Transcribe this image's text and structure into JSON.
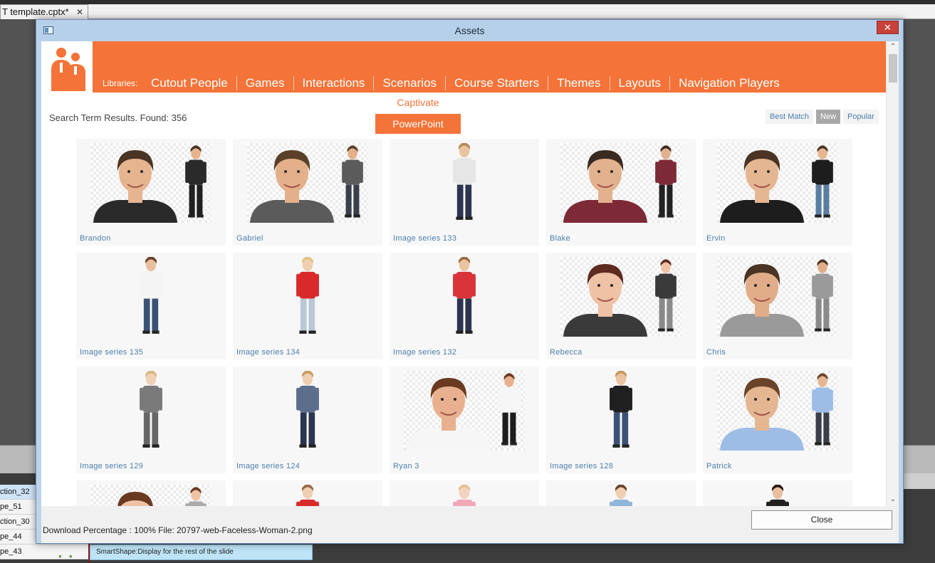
{
  "app": {
    "doc_tab": "T template.cptx*",
    "doc_tab_close": "✕",
    "timeline_rows": [
      {
        "label": "ction_32",
        "selected": true
      },
      {
        "label": "pe_51",
        "selected": false
      },
      {
        "label": "ction_30",
        "selected": false
      },
      {
        "label": "pe_44",
        "selected": false
      },
      {
        "label": "pe_43",
        "selected": false
      }
    ],
    "timeline_smartshape": "SmartShape:Display for the rest of the slide"
  },
  "dialog": {
    "title": "Assets",
    "close_glyph": "✕",
    "libraries_label": "Libraries:",
    "nav": [
      "Cutout People",
      "Games",
      "Interactions",
      "Scenarios",
      "Course Starters",
      "Themes",
      "Layouts",
      "Navigation Players"
    ],
    "submenu": {
      "captivate": "Captivate",
      "powerpoint": "PowerPoint"
    },
    "results_text": "Search Term Results. Found: 356",
    "sort_options": [
      {
        "label": "Best Match",
        "active": false
      },
      {
        "label": "New",
        "active": true
      },
      {
        "label": "Popular",
        "active": false
      }
    ],
    "scroll_up": "⌃",
    "scroll_down": "⌄",
    "grid": [
      {
        "caption": "Brandon",
        "kind": "pair",
        "skin": "#e6b48f",
        "hair": "#4a3424",
        "shirt": "#2a2a2a",
        "pants": "#202020"
      },
      {
        "caption": "Gabriel",
        "kind": "pair",
        "skin": "#e3b08a",
        "hair": "#5a4028",
        "shirt": "#5b5b5b",
        "pants": "#3a3f4a"
      },
      {
        "caption": "Image series 133",
        "kind": "single",
        "skin": "#eac3a0",
        "hair": "#b4895a",
        "shirt": "#e6e6e6",
        "pants": "#2c3550"
      },
      {
        "caption": "Blake",
        "kind": "pair",
        "skin": "#e2b18e",
        "hair": "#3a2a20",
        "shirt": "#7d2a36",
        "pants": "#222"
      },
      {
        "caption": "Ervin",
        "kind": "pair",
        "skin": "#e5b692",
        "hair": "#4b3424",
        "shirt": "#1d1d1d",
        "pants": "#5a7ea0"
      },
      {
        "caption": "Image series 135",
        "kind": "single",
        "skin": "#e8c0a0",
        "hair": "#6a4028",
        "shirt": "#f4f4f4",
        "pants": "#3b5276"
      },
      {
        "caption": "Image series 134",
        "kind": "single",
        "skin": "#efcfb2",
        "hair": "#e1c38a",
        "shirt": "#d82a2a",
        "pants": "#b9c8d4"
      },
      {
        "caption": "Image series 132",
        "kind": "single",
        "skin": "#eac3a0",
        "hair": "#9a6a40",
        "shirt": "#d8343a",
        "pants": "#2c3550"
      },
      {
        "caption": "Rebecca",
        "kind": "pair",
        "skin": "#efc2a6",
        "hair": "#5e2a20",
        "shirt": "#3a3a3a",
        "pants": "#8a8a8a"
      },
      {
        "caption": "Chris",
        "kind": "pair",
        "skin": "#e0ad88",
        "hair": "#4a3424",
        "shirt": "#9a9a9a",
        "pants": "#8a8a8a"
      },
      {
        "caption": "Image series 129",
        "kind": "single",
        "skin": "#f0d0b4",
        "hair": "#d9b880",
        "shirt": "#7a7a7a",
        "pants": "#666"
      },
      {
        "caption": "Image series 124",
        "kind": "single",
        "skin": "#efcfb2",
        "hair": "#c99a60",
        "shirt": "#5b6f8c",
        "pants": "#2c3550"
      },
      {
        "caption": "Ryan 3",
        "kind": "pair",
        "skin": "#e9b08f",
        "hair": "#6a3a20",
        "shirt": "#f6f6f6",
        "pants": "#1d1d1d"
      },
      {
        "caption": "Image series 128",
        "kind": "single",
        "skin": "#eac3a0",
        "hair": "#c6985e",
        "shirt": "#202020",
        "pants": "#3b5276"
      },
      {
        "caption": "Patrick",
        "kind": "pair",
        "skin": "#e5b692",
        "hair": "#6a4428",
        "shirt": "#9dbde6",
        "pants": "#3a3f4a"
      },
      {
        "caption": "",
        "kind": "pair",
        "skin": "#efc2a6",
        "hair": "#6a3a20",
        "shirt": "#aaa",
        "pants": "#777"
      },
      {
        "caption": "",
        "kind": "single",
        "skin": "#efcfb2",
        "hair": "#9a6a40",
        "shirt": "#d82a2a",
        "pants": "#333"
      },
      {
        "caption": "",
        "kind": "single",
        "skin": "#f4d2c0",
        "hair": "#e8c090",
        "shirt": "#f0a8b8",
        "pants": "#ccc"
      },
      {
        "caption": "",
        "kind": "single",
        "skin": "#efcfb2",
        "hair": "#6a4028",
        "shirt": "#8fb6d8",
        "pants": "#333"
      },
      {
        "caption": "",
        "kind": "single",
        "skin": "#e8c0a0",
        "hair": "#2a1a10",
        "shirt": "#202020",
        "pants": "#333"
      }
    ],
    "download_text": "Download Percentage : 100%  File: 20797-web-Faceless-Woman-2.png",
    "close_button": "Close",
    "colors": {
      "brand": "#f47338",
      "link": "#4b7fad",
      "title_bar": "#b7d0e9",
      "close_red": "#c9413a"
    }
  }
}
